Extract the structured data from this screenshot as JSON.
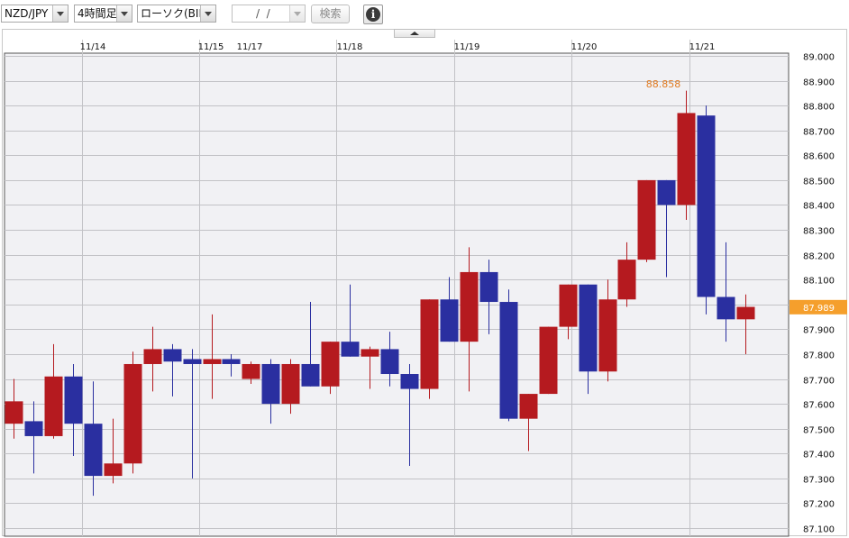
{
  "toolbar": {
    "pair": "NZD/JPY",
    "timeframe": "4時間足",
    "chart_kind": "ローソク(BID)",
    "date_value": "/  /",
    "search_label": "検索",
    "info_icon": "info-icon",
    "info_glyph": "i"
  },
  "colors": {
    "up": "#b51a1f",
    "down": "#2a2fa0",
    "grid": "#c2c2c6",
    "plot_bg": "#f1f1f4",
    "current_price_bg": "#f59f2c",
    "high_label": "#e07a20"
  },
  "chart_data": {
    "type": "candlestick",
    "x_labels": [
      "11/14",
      "11/15",
      "11/17",
      "11/18",
      "11/19",
      "11/20",
      "11/21"
    ],
    "ylim": [
      87.05,
      89.05
    ],
    "y_ticks": [
      "89.000",
      "88.900",
      "88.800",
      "88.700",
      "88.600",
      "88.500",
      "88.400",
      "88.300",
      "88.200",
      "88.100",
      "88.000",
      "87.900",
      "87.800",
      "87.700",
      "87.600",
      "87.500",
      "87.400",
      "87.300",
      "87.200",
      "87.100"
    ],
    "current_price": "87.989",
    "high_annotation": "88.858",
    "candles": [
      {
        "o": 87.52,
        "h": 87.7,
        "l": 87.46,
        "c": 87.61
      },
      {
        "o": 87.53,
        "h": 87.61,
        "l": 87.32,
        "c": 87.47
      },
      {
        "o": 87.47,
        "h": 87.84,
        "l": 87.46,
        "c": 87.71
      },
      {
        "o": 87.71,
        "h": 87.76,
        "l": 87.39,
        "c": 87.52
      },
      {
        "o": 87.52,
        "h": 87.69,
        "l": 87.23,
        "c": 87.31
      },
      {
        "o": 87.31,
        "h": 87.54,
        "l": 87.28,
        "c": 87.36
      },
      {
        "o": 87.36,
        "h": 87.81,
        "l": 87.32,
        "c": 87.76
      },
      {
        "o": 87.76,
        "h": 87.91,
        "l": 87.65,
        "c": 87.82
      },
      {
        "o": 87.82,
        "h": 87.84,
        "l": 87.63,
        "c": 87.77
      },
      {
        "o": 87.78,
        "h": 87.82,
        "l": 87.3,
        "c": 87.76
      },
      {
        "o": 87.76,
        "h": 87.96,
        "l": 87.62,
        "c": 87.78
      },
      {
        "o": 87.78,
        "h": 87.8,
        "l": 87.71,
        "c": 87.76
      },
      {
        "o": 87.7,
        "h": 87.77,
        "l": 87.68,
        "c": 87.76
      },
      {
        "o": 87.76,
        "h": 87.78,
        "l": 87.52,
        "c": 87.6
      },
      {
        "o": 87.6,
        "h": 87.78,
        "l": 87.56,
        "c": 87.76
      },
      {
        "o": 87.76,
        "h": 88.01,
        "l": 87.67,
        "c": 87.67
      },
      {
        "o": 87.67,
        "h": 87.85,
        "l": 87.64,
        "c": 87.85
      },
      {
        "o": 87.85,
        "h": 88.08,
        "l": 87.79,
        "c": 87.79
      },
      {
        "o": 87.79,
        "h": 87.83,
        "l": 87.66,
        "c": 87.82
      },
      {
        "o": 87.82,
        "h": 87.89,
        "l": 87.67,
        "c": 87.72
      },
      {
        "o": 87.72,
        "h": 87.76,
        "l": 87.35,
        "c": 87.66
      },
      {
        "o": 87.66,
        "h": 88.02,
        "l": 87.62,
        "c": 88.02
      },
      {
        "o": 88.02,
        "h": 88.11,
        "l": 87.85,
        "c": 87.85
      },
      {
        "o": 87.85,
        "h": 88.23,
        "l": 87.65,
        "c": 88.13
      },
      {
        "o": 88.13,
        "h": 88.18,
        "l": 87.88,
        "c": 88.01
      },
      {
        "o": 88.01,
        "h": 88.06,
        "l": 87.53,
        "c": 87.54
      },
      {
        "o": 87.54,
        "h": 87.64,
        "l": 87.41,
        "c": 87.64
      },
      {
        "o": 87.64,
        "h": 87.91,
        "l": 87.64,
        "c": 87.91
      },
      {
        "o": 87.91,
        "h": 88.08,
        "l": 87.86,
        "c": 88.08
      },
      {
        "o": 88.08,
        "h": 88.08,
        "l": 87.64,
        "c": 87.73
      },
      {
        "o": 87.73,
        "h": 88.1,
        "l": 87.69,
        "c": 88.02
      },
      {
        "o": 88.02,
        "h": 88.25,
        "l": 87.99,
        "c": 88.18
      },
      {
        "o": 88.18,
        "h": 88.5,
        "l": 88.17,
        "c": 88.5
      },
      {
        "o": 88.5,
        "h": 88.5,
        "l": 88.11,
        "c": 88.4
      },
      {
        "o": 88.4,
        "h": 88.86,
        "l": 88.34,
        "c": 88.77
      },
      {
        "o": 88.76,
        "h": 88.8,
        "l": 87.96,
        "c": 88.03
      },
      {
        "o": 88.03,
        "h": 88.25,
        "l": 87.85,
        "c": 87.94
      },
      {
        "o": 87.94,
        "h": 88.04,
        "l": 87.8,
        "c": 87.99
      }
    ]
  }
}
